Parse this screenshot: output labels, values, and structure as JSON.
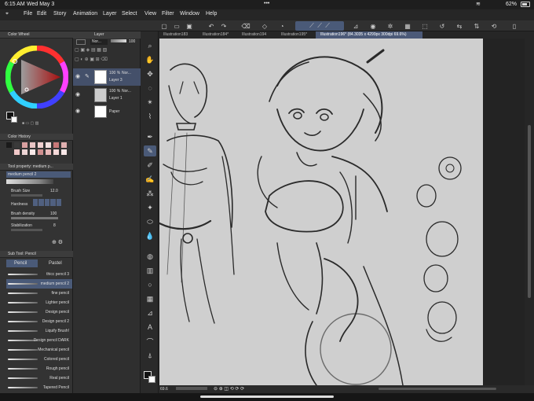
{
  "status": {
    "time": "6:15 AM",
    "date": "Wed May 3",
    "battery": "62%"
  },
  "menu": [
    "File",
    "Edit",
    "Story",
    "Animation",
    "Layer",
    "Select",
    "View",
    "Filter",
    "Window",
    "Help"
  ],
  "panels": {
    "color_wheel": "Color Wheel",
    "color_history": "Color History",
    "tool_property": "Tool property: medium p...",
    "sub_tool": "Sub Tool: Pencil"
  },
  "tool_property": {
    "brush_name": "medium pencil 2",
    "brush_size_label": "Brush Size",
    "brush_size_value": "12.0",
    "hardness_label": "Hardness",
    "brush_density_label": "Brush density",
    "brush_density_value": "100",
    "stabilization_label": "Stabilization",
    "stabilization_value": "8"
  },
  "subtool_tabs": [
    "Pencil",
    "Pastel"
  ],
  "brushes": [
    "thicc pencil 3",
    "medium pencil 2",
    "fine pencil",
    "Lighter pencil",
    "Design pencil",
    "Design pencil 2",
    "Liquify Brush!",
    "Design pencil DARK",
    "Mechanical pencil",
    "Colored pencil",
    "Rough pencil",
    "Real pencil",
    "Tapered Pencil"
  ],
  "selected_brush": "medium pencil 2",
  "layer_panel": {
    "title": "Layer",
    "blend": "Nor...",
    "opacity": "100",
    "layers": [
      {
        "opacity": "100 %",
        "blend": "Nor...",
        "name": "Layer 3"
      },
      {
        "opacity": "100 %",
        "blend": "Nor...",
        "name": "Layer 1"
      },
      {
        "opacity": "",
        "blend": "",
        "name": "Paper"
      }
    ]
  },
  "doc_tabs": [
    "Illustration183",
    "Illustration184*",
    "Illustration194",
    "Illustration195*",
    "Illustration196* (84.3035 x 4299px 300dpi 69.6%)"
  ],
  "zoom": "69.6",
  "colors": {
    "accent": "#4a5a78",
    "canvas": "#cfcfcf"
  },
  "history_colors": [
    "#1a1a1a",
    "#3a3a3a",
    "#d8a0a0",
    "#e8c4c4",
    "#f0d0d0",
    "#f4e0e0",
    "#c87878",
    "#e0b0b0",
    "#333333",
    "#f0c8c8",
    "#ecd4d4",
    "#f8e8e8",
    "#d09090",
    "#e8b8b8",
    "#f4d8d8",
    "#fae8e8"
  ]
}
